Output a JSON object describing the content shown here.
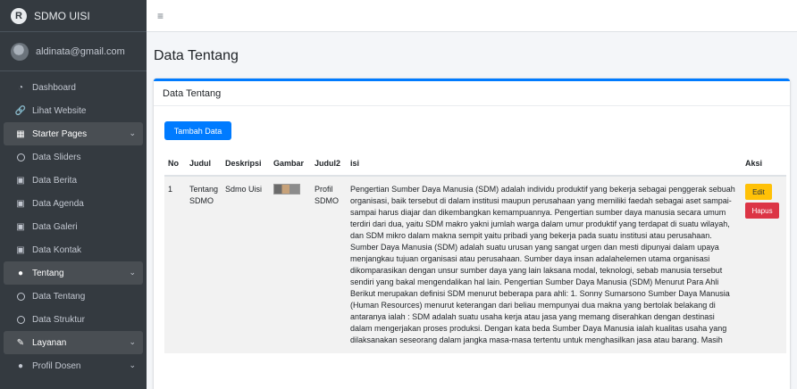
{
  "brand": {
    "name": "SDMO UISI",
    "logo_letter": "R"
  },
  "user": {
    "email": "aldinata@gmail.com"
  },
  "sidebar": {
    "items": [
      {
        "label": "Dashboard",
        "icon": "dashboard-icon"
      },
      {
        "label": "Lihat Website",
        "icon": "link-icon"
      },
      {
        "label": "Starter Pages",
        "icon": "grid-icon",
        "active": true,
        "chevron": true
      },
      {
        "label": "Data Sliders",
        "icon": "circle-icon"
      },
      {
        "label": "Data Berita",
        "icon": "image-icon"
      },
      {
        "label": "Data Agenda",
        "icon": "calendar-icon"
      },
      {
        "label": "Data Galeri",
        "icon": "photo-icon"
      },
      {
        "label": "Data Kontak",
        "icon": "contact-icon"
      },
      {
        "label": "Tentang",
        "icon": "user-icon",
        "active": true,
        "chevron": true
      },
      {
        "label": "Data Tentang",
        "icon": "circle-icon"
      },
      {
        "label": "Data Struktur",
        "icon": "circle-icon"
      },
      {
        "label": "Layanan",
        "icon": "edit-icon",
        "active": true,
        "chevron": true
      },
      {
        "label": "Profil Dosen",
        "icon": "user-icon",
        "chevron": true
      }
    ]
  },
  "topbar": {
    "menu_icon": "hamburger-icon"
  },
  "page": {
    "title": "Data Tentang"
  },
  "card": {
    "title": "Data Tentang",
    "add_button": "Tambah Data"
  },
  "table": {
    "headers": [
      "No",
      "Judul",
      "Deskripsi",
      "Gambar",
      "Judul2",
      "isi",
      "Aksi"
    ],
    "rows": [
      {
        "no": "1",
        "judul": "Tentang SDMO",
        "deskripsi": "Sdmo Uisi",
        "judul2": "Profil SDMO",
        "isi": "Pengertian Sumber Daya Manusia (SDM) adalah individu produktif yang bekerja sebagai penggerak sebuah organisasi, baik tersebut di dalam institusi maupun perusahaan yang memiliki faedah sebagai aset sampai-sampai harus diajar dan dikembangkan kemampuannya. Pengertian sumber daya manusia secara umum terdiri dari dua, yaitu SDM makro yakni jumlah warga dalam umur produktif yang terdapat di suatu wilayah, dan SDM mikro dalam makna sempit yaitu pribadi yang bekerja pada suatu institusi atau perusahaan. Sumber Daya Manusia (SDM) adalah suatu urusan yang sangat urgen dan mesti dipunyai dalam upaya menjangkau tujuan organisasi atau perusahaan. Sumber daya insan adalahelemen utama organisasi dikomparasikan dengan unsur sumber daya yang lain laksana modal, teknologi, sebab manusia tersebut sendiri yang bakal mengendalikan hal lain. Pengertian Sumber Daya Manusia (SDM) Menurut Para Ahli Berikut merupakan definisi SDM menurut beberapa para ahli: 1. Sonny Sumarsono Sumber Daya Manusia (Human Resources) menurut keterangan dari beliau mempunyai dua makna yang bertolak belakang di antaranya ialah : SDM adalah suatu usaha kerja atau jasa yang memang diserahkan dengan destinasi dalam mengerjakan proses produksi. Dengan kata beda Sumber Daya Manusia ialah kualitas usaha yang dilaksanakan seseorang dalam jangka masa-masa tertentu untuk menghasilkan jasa atau barang. Masih",
        "edit_label": "Edit",
        "delete_label": "Hapus"
      }
    ]
  }
}
